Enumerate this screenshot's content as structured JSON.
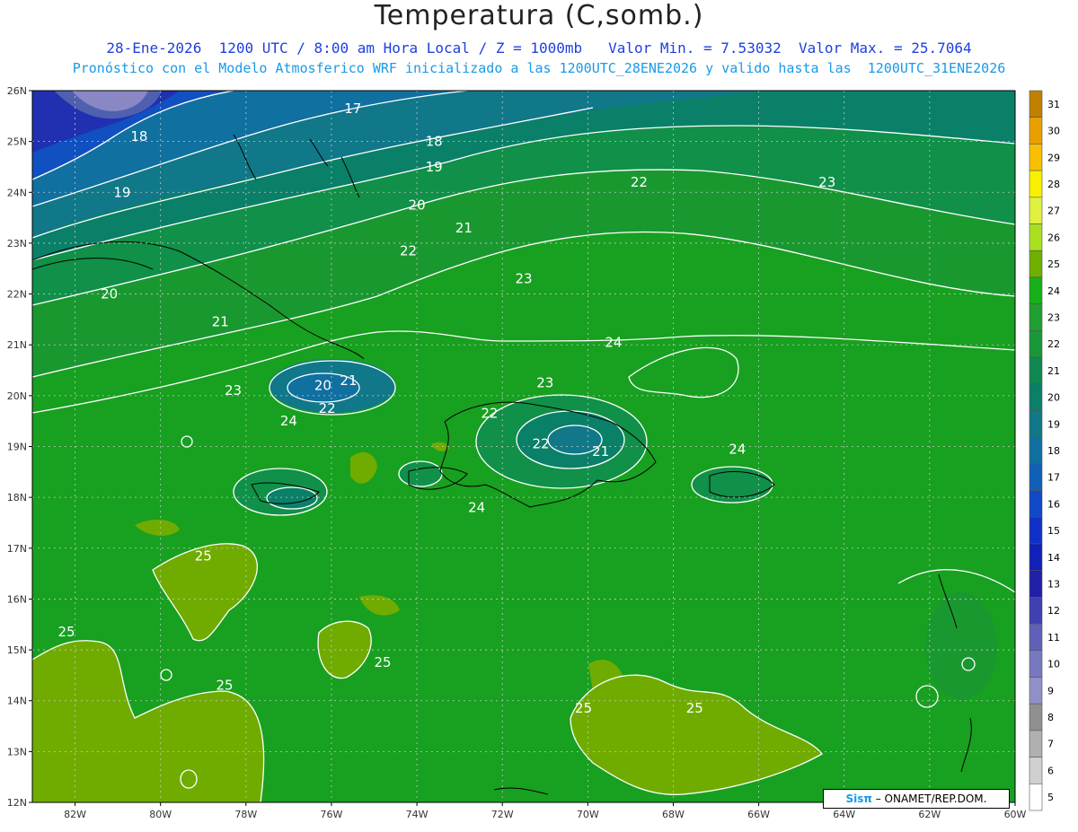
{
  "title": "Temperatura (C,somb.)",
  "subtitle1": "28-Ene-2026  1200 UTC / 8:00 am Hora Local / Z = 1000mb   Valor Min. = 7.53032  Valor Max. = 25.7064",
  "subtitle2": "Pronóstico con el Modelo Atmosferico WRF inicializado a las 1200UTC_28ENE2026 y valido hasta las  1200UTC_31ENE2026",
  "credit": {
    "brand": "Sisπ",
    "text": " – ONAMET/REP.DOM."
  },
  "lat_labels": [
    "26N",
    "25N",
    "24N",
    "23N",
    "22N",
    "21N",
    "20N",
    "19N",
    "18N",
    "17N",
    "16N",
    "15N",
    "14N",
    "13N",
    "12N"
  ],
  "lon_labels": [
    "82W",
    "80W",
    "78W",
    "76W",
    "74W",
    "72W",
    "70W",
    "68W",
    "66W",
    "64W",
    "62W",
    "60W"
  ],
  "colorbar": {
    "levels": [
      "31",
      "30",
      "29",
      "28",
      "27",
      "26",
      "25",
      "24",
      "23",
      "22",
      "21",
      "20",
      "19",
      "18",
      "17",
      "16",
      "15",
      "14",
      "13",
      "12",
      "11",
      "10",
      "9",
      "8",
      "7",
      "6",
      "5"
    ],
    "colors": [
      "#c08000",
      "#e8a000",
      "#f8c000",
      "#f8f000",
      "#e0f040",
      "#a8e020",
      "#70b000",
      "#18b018",
      "#20a030",
      "#189838",
      "#108850",
      "#0a8068",
      "#107888",
      "#1070a0",
      "#1060b8",
      "#1048c8",
      "#1030c8",
      "#1020b8",
      "#2020a8",
      "#4040b0",
      "#6060b8",
      "#7878c0",
      "#9090c8",
      "#909090",
      "#b0b0b0",
      "#d0d0d0",
      "#ffffff"
    ]
  },
  "contour_labels": [
    {
      "text": "17",
      "lon": -75.5,
      "lat": 25.65
    },
    {
      "text": "18",
      "lon": -80.5,
      "lat": 25.1
    },
    {
      "text": "18",
      "lon": -73.6,
      "lat": 25.0
    },
    {
      "text": "19",
      "lon": -80.9,
      "lat": 24.0
    },
    {
      "text": "19",
      "lon": -73.6,
      "lat": 24.5
    },
    {
      "text": "20",
      "lon": -74.0,
      "lat": 23.75
    },
    {
      "text": "21",
      "lon": -72.9,
      "lat": 23.3
    },
    {
      "text": "22",
      "lon": -68.8,
      "lat": 24.2
    },
    {
      "text": "23",
      "lon": -64.4,
      "lat": 24.2
    },
    {
      "text": "22",
      "lon": -74.2,
      "lat": 22.85
    },
    {
      "text": "23",
      "lon": -71.5,
      "lat": 22.3
    },
    {
      "text": "20",
      "lon": -81.2,
      "lat": 22.0
    },
    {
      "text": "21",
      "lon": -78.6,
      "lat": 21.45
    },
    {
      "text": "24",
      "lon": -69.4,
      "lat": 21.05
    },
    {
      "text": "23",
      "lon": -78.3,
      "lat": 20.1
    },
    {
      "text": "20",
      "lon": -76.2,
      "lat": 20.2
    },
    {
      "text": "21",
      "lon": -75.6,
      "lat": 20.3
    },
    {
      "text": "22",
      "lon": -76.1,
      "lat": 19.75
    },
    {
      "text": "24",
      "lon": -77.0,
      "lat": 19.5
    },
    {
      "text": "23",
      "lon": -71.0,
      "lat": 20.25
    },
    {
      "text": "22",
      "lon": -72.3,
      "lat": 19.65
    },
    {
      "text": "22",
      "lon": -71.1,
      "lat": 19.05
    },
    {
      "text": "21",
      "lon": -69.7,
      "lat": 18.9
    },
    {
      "text": "24",
      "lon": -66.5,
      "lat": 18.95
    },
    {
      "text": "24",
      "lon": -72.6,
      "lat": 17.8
    },
    {
      "text": "25",
      "lon": -79.0,
      "lat": 16.85
    },
    {
      "text": "25",
      "lon": -82.2,
      "lat": 15.35
    },
    {
      "text": "25",
      "lon": -74.8,
      "lat": 14.75
    },
    {
      "text": "25",
      "lon": -78.5,
      "lat": 14.3
    },
    {
      "text": "25",
      "lon": -70.1,
      "lat": 13.85
    },
    {
      "text": "25",
      "lon": -67.5,
      "lat": 13.85
    }
  ]
}
